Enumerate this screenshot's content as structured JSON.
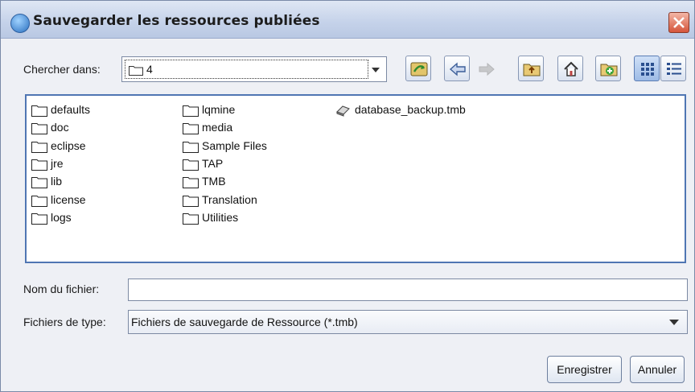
{
  "window": {
    "title": "Sauvegarder les ressources publiées"
  },
  "lookin": {
    "label": "Chercher dans:",
    "value": "4"
  },
  "toolbar": {
    "icons": [
      "refresh-icon",
      "back-icon",
      "forward-icon",
      "up-folder-icon",
      "home-icon",
      "new-folder-icon",
      "list-view-icon",
      "details-view-icon"
    ]
  },
  "files": {
    "col1": [
      "defaults",
      "doc",
      "eclipse",
      "jre",
      "lib",
      "license",
      "logs"
    ],
    "col2": [
      "lqmine",
      "media",
      "Sample Files",
      "TAP",
      "TMB",
      "Translation",
      "Utilities"
    ],
    "col3": [
      "database_backup.tmb"
    ]
  },
  "filename": {
    "label": "Nom du fichier:",
    "value": ""
  },
  "filetype": {
    "label": "Fichiers de type:",
    "value": "Fichiers de sauvegarde de Ressource (*.tmb)"
  },
  "buttons": {
    "save": "Enregistrer",
    "cancel": "Annuler"
  }
}
